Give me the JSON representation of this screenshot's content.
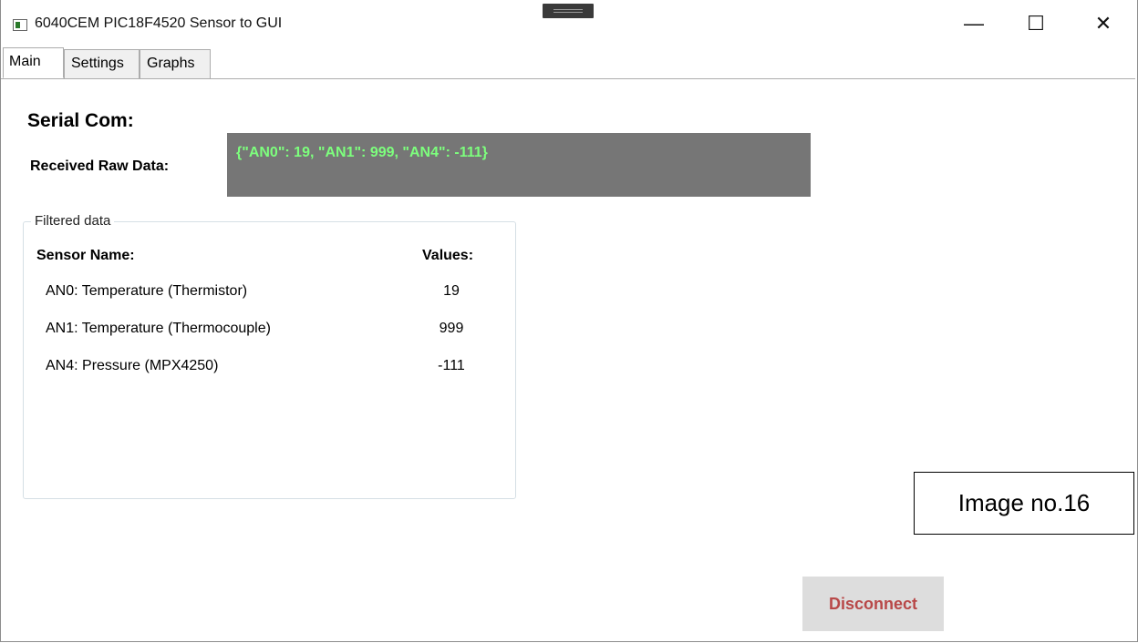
{
  "window": {
    "title": "6040CEM PIC18F4520 Sensor to GUI",
    "minimize_glyph": "—",
    "maximize_glyph": "☐",
    "close_glyph": "✕"
  },
  "tabs": [
    {
      "label": "Main",
      "selected": true
    },
    {
      "label": "Settings",
      "selected": false
    },
    {
      "label": "Graphs",
      "selected": false
    }
  ],
  "main": {
    "serial_heading": "Serial Com:",
    "raw_label": "Received Raw Data:",
    "raw_value": "{\"AN0\": 19, \"AN1\": 999, \"AN4\": -111}",
    "raw_text_color": "#7dff7d",
    "raw_bg_color": "#767676"
  },
  "filtered": {
    "legend": "Filtered data",
    "col_name": "Sensor Name:",
    "col_value": "Values:",
    "rows": [
      {
        "name": "AN0: Temperature (Thermistor)",
        "value": "19"
      },
      {
        "name": "AN1: Temperature (Thermocouple)",
        "value": "999"
      },
      {
        "name": "AN4: Pressure (MPX4250)",
        "value": "-111"
      }
    ]
  },
  "annotation": "Image no.16",
  "disconnect_label": "Disconnect",
  "disconnect_color": "#b84848"
}
